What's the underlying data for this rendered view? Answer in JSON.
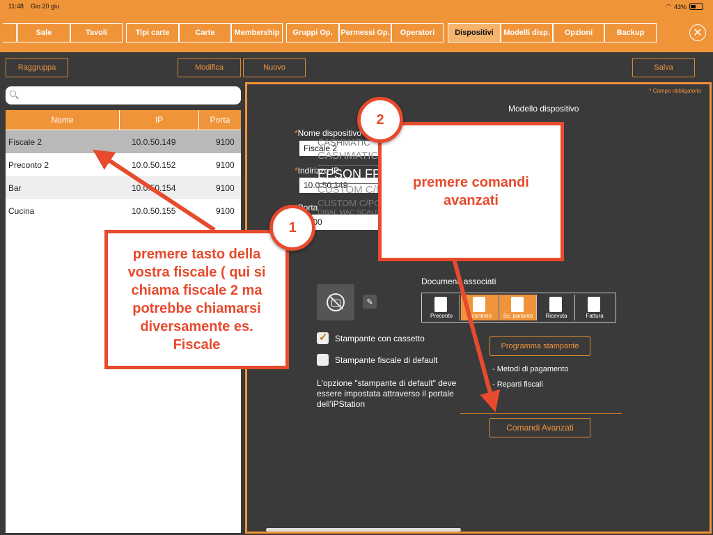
{
  "status_bar": {
    "time": "11:48",
    "date": "Gio 20 giu",
    "battery": "43%"
  },
  "tabs": [
    {
      "label": "Sale"
    },
    {
      "label": "Tavoli"
    },
    {
      "label": "Tipi carte"
    },
    {
      "label": "Carte"
    },
    {
      "label": "Membership"
    },
    {
      "label": "Gruppi Op."
    },
    {
      "label": "Permessi Op."
    },
    {
      "label": "Operatori"
    },
    {
      "label": "Dispositivi"
    },
    {
      "label": "Modelli disp."
    },
    {
      "label": "Opzioni"
    },
    {
      "label": "Backup"
    }
  ],
  "toolbar": {
    "group": "Raggruppa",
    "edit": "Modifica",
    "new": "Nuovo",
    "save": "Salva"
  },
  "list": {
    "headers": {
      "name": "Nome",
      "ip": "IP",
      "port": "Porta"
    },
    "rows": [
      {
        "name": "Fiscale 2",
        "ip": "10.0.50.149",
        "port": "9100"
      },
      {
        "name": "Preconto 2",
        "ip": "10.0.50.152",
        "port": "9100"
      },
      {
        "name": "Bar",
        "ip": "10.0.50.154",
        "port": "9100"
      },
      {
        "name": "Cucina",
        "ip": "10.0.50.155",
        "port": "9100"
      }
    ]
  },
  "form": {
    "required_note": "* Campo obbligatorio",
    "model_title": "Modello dispositivo",
    "name_label": "Nome dispositivo",
    "name_value": "Fiscale 2",
    "ip_label": "Indirizzo IP",
    "ip_value": "10.0.50.149",
    "port_label": "Porta",
    "port_value": "9100",
    "models": [
      "CASHMATIC",
      "CASHMATIC",
      "EPSON FP81II",
      "CUSTOM C/POS NOTCH",
      "CUSTOM C/POS THERMAL",
      "DIBAL MAC SCALES"
    ],
    "docs_title": "Documenti associati",
    "docs": [
      {
        "label": "Preconto",
        "on": false
      },
      {
        "label": "Scontrino",
        "on": true
      },
      {
        "label": "Sc. parlante",
        "on": true
      },
      {
        "label": "Ricevuta",
        "on": false
      },
      {
        "label": "Fattura",
        "on": false
      }
    ],
    "check_drawer": "Stampante con cassetto",
    "check_default": "Stampante fiscale di default",
    "note": "L'opzione \"stampante di default\" deve essere impostata attraverso il portale dell'iPStation",
    "program_printer": "Programma stampante",
    "bullet1": "- Metodi di pagamento",
    "bullet2": "- Reparti fiscali",
    "advanced": "Comandi Avanzati"
  },
  "annotations": {
    "step1_number": "1",
    "step1_text": "premere tasto della vostra fiscale ( qui si chiama fiscale 2 ma potrebbe chiamarsi diversamente es. Fiscale",
    "step2_number": "2",
    "step2_text": "premere comandi avanzati"
  },
  "colors": {
    "accent": "#f0943a",
    "background": "#3a3a3a",
    "annotation_red": "#e74a2d"
  }
}
